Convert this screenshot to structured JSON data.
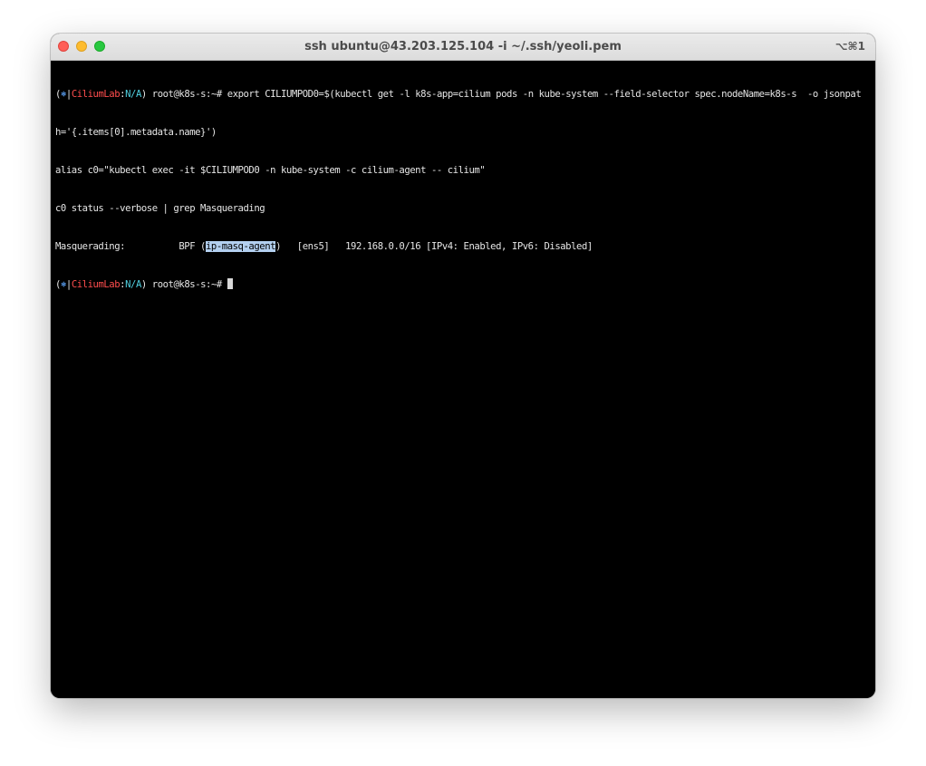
{
  "window": {
    "title": "ssh ubuntu@43.203.125.104 -i ~/.ssh/yeoli.pem",
    "shortcut": "⌥⌘1"
  },
  "prompt": {
    "open": "(",
    "kube_icon": "⎈",
    "sep": "|",
    "context": "CiliumLab",
    "colon": ":",
    "namespace": "N/A",
    "close": ")",
    "user_host": " root@k8s-s:~# "
  },
  "terminal": {
    "cmd_export_1": "export CILIUMPOD0=$(kubectl get -l k8s-app=cilium pods -n kube-system --field-selector spec.nodeName=k8s-s  -o jsonpat",
    "cmd_export_2": "h='{.items[0].metadata.name}')",
    "cmd_alias": "alias c0=\"kubectl exec -it $CILIUMPOD0 -n kube-system -c cilium-agent -- cilium\"",
    "cmd_status": "c0 status --verbose | grep Masquerading",
    "out_prefix": "Masquerading:          BPF (",
    "out_selected": "ip-masq-agent",
    "out_suffix": ")   [ens5]   192.168.0.0/16 [IPv4: Enabled, IPv6: Disabled]"
  },
  "colors": {
    "kube_icon": "#5fa8ff",
    "context": "#ff4d4d",
    "namespace": "#4fd0e0",
    "selection": "#b3d0f0"
  }
}
